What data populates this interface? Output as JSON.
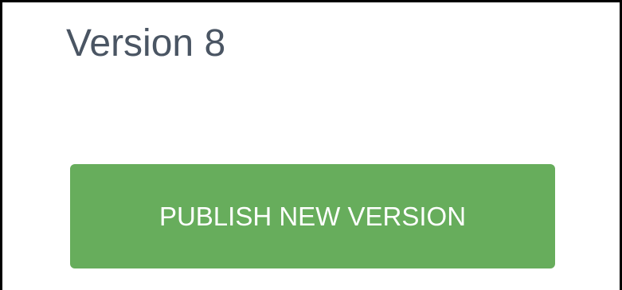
{
  "header": {
    "version_title": "Version 8"
  },
  "actions": {
    "publish_label": "PUBLISH NEW VERSION"
  },
  "colors": {
    "title_text": "#4a5563",
    "publish_button_bg": "#67ad5c",
    "publish_button_text": "#ffffff",
    "frame_border": "#000000"
  }
}
